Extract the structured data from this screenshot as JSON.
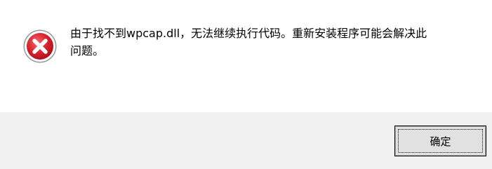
{
  "dialog": {
    "icon": "error-icon",
    "message_line1": "由于找不到wpcap.dll，无法继续执行代码。重新安装程序可能会解决此",
    "message_line2": "问题。",
    "ok_label": "确定"
  },
  "colors": {
    "content_bg": "#ffffff",
    "footer_bg": "#f0f0f0",
    "icon_red": "#d9232e",
    "button_bg": "#e1e1e1"
  }
}
